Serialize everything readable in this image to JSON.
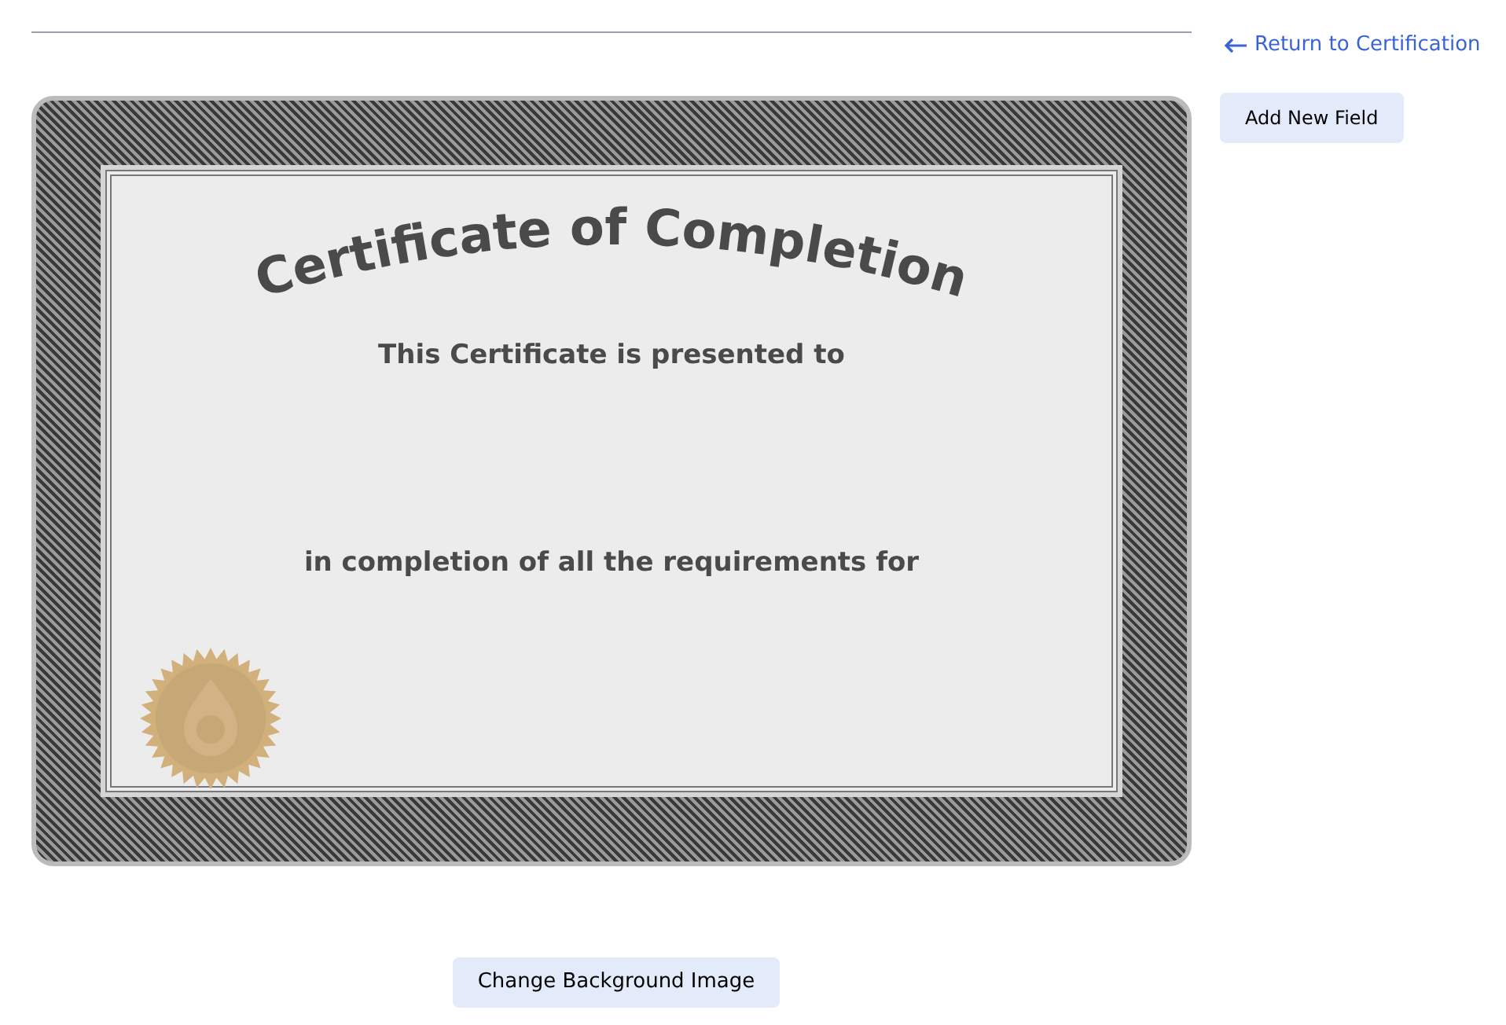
{
  "return_link": {
    "label": "Return to Certification"
  },
  "add_field_button": {
    "label": "Add New Field"
  },
  "certificate": {
    "title": "Certificate of Completion",
    "presented_line": "This Certificate is presented to",
    "completion_line": "in completion of all the requirements for"
  },
  "change_background_button": {
    "label": "Change Background Image"
  }
}
